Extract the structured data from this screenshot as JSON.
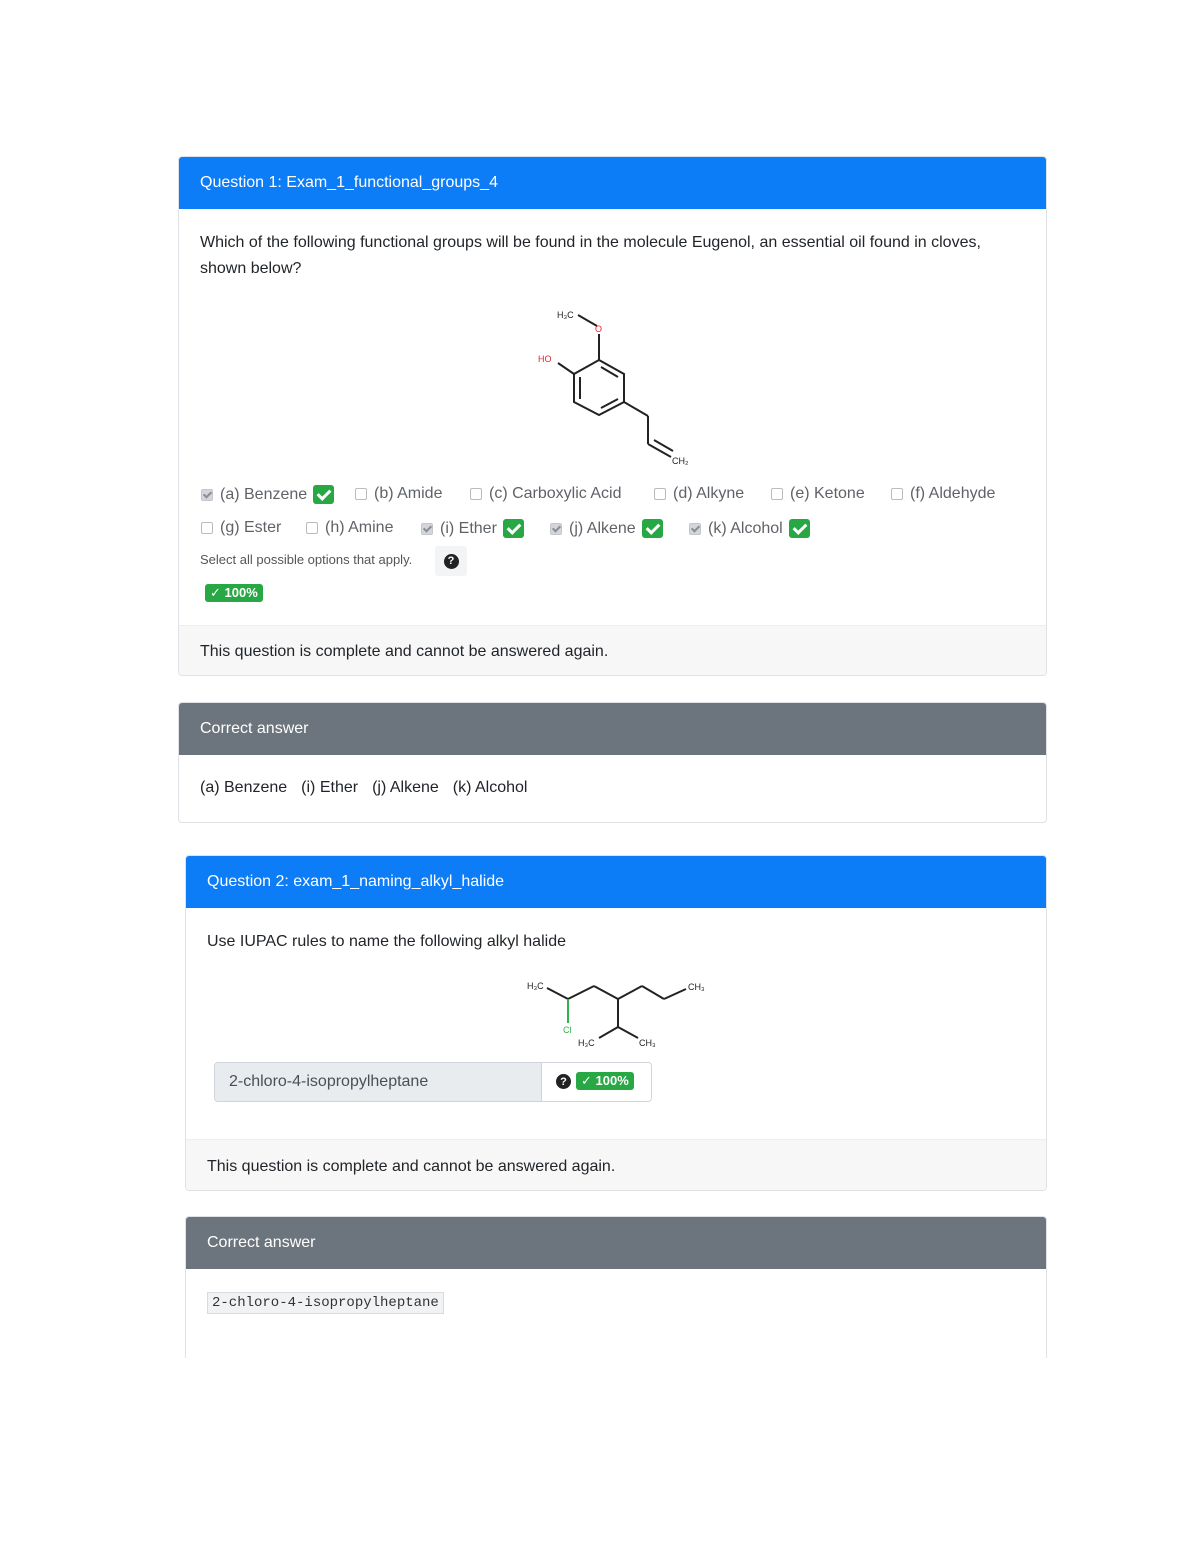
{
  "question1": {
    "header": "Question 1: Exam_1_functional_groups_4",
    "text": "Which of the following functional groups will be found in the molecule Eugenol, an essential oil found in cloves, shown below?",
    "molecule_labels": {
      "h3c": "H₃C",
      "o": "O",
      "ho": "HO",
      "ch2": "CH₂"
    },
    "options": [
      {
        "label": "(a) Benzene",
        "checked": true,
        "correct": true
      },
      {
        "label": "(b) Amide",
        "checked": false,
        "correct": false
      },
      {
        "label": "(c) Carboxylic Acid",
        "checked": false,
        "correct": false
      },
      {
        "label": "(d) Alkyne",
        "checked": false,
        "correct": false
      },
      {
        "label": "(e) Ketone",
        "checked": false,
        "correct": false
      },
      {
        "label": "(f)  Aldehyde",
        "checked": false,
        "correct": false
      },
      {
        "label": "(g) Ester",
        "checked": false,
        "correct": false
      },
      {
        "label": "(h) Amine",
        "checked": false,
        "correct": false
      },
      {
        "label": "(i)  Ether",
        "checked": true,
        "correct": true
      },
      {
        "label": "(j)  Alkene",
        "checked": true,
        "correct": true
      },
      {
        "label": "(k) Alcohol",
        "checked": true,
        "correct": true
      }
    ],
    "hint": "Select all possible options that apply.",
    "score": "100%",
    "footer": "This question is complete and cannot be answered again."
  },
  "answer1": {
    "header": "Correct answer",
    "items": [
      "(a) Benzene",
      "(i) Ether",
      "(j) Alkene",
      "(k) Alcohol"
    ]
  },
  "question2": {
    "header": "Question 2: exam_1_naming_alkyl_halide",
    "text": "Use IUPAC rules to name the following alkyl halide",
    "molecule_labels": {
      "h3c_top": "H₃C",
      "ch3_right": "CH₃",
      "cl": "Cl",
      "h3c_bottom": "H₃C",
      "ch3_bottom": "CH₃"
    },
    "answer_value": "2-chloro-4-isopropylheptane",
    "score": "100%",
    "footer": "This question is complete and cannot be answered again."
  },
  "answer2": {
    "header": "Correct answer",
    "value": "2-chloro-4-isopropylheptane"
  },
  "colors": {
    "primary": "#0d7cf7",
    "secondary": "#6c757d",
    "success": "#28a745"
  },
  "icons": [
    "check-icon",
    "question-circle-icon"
  ]
}
